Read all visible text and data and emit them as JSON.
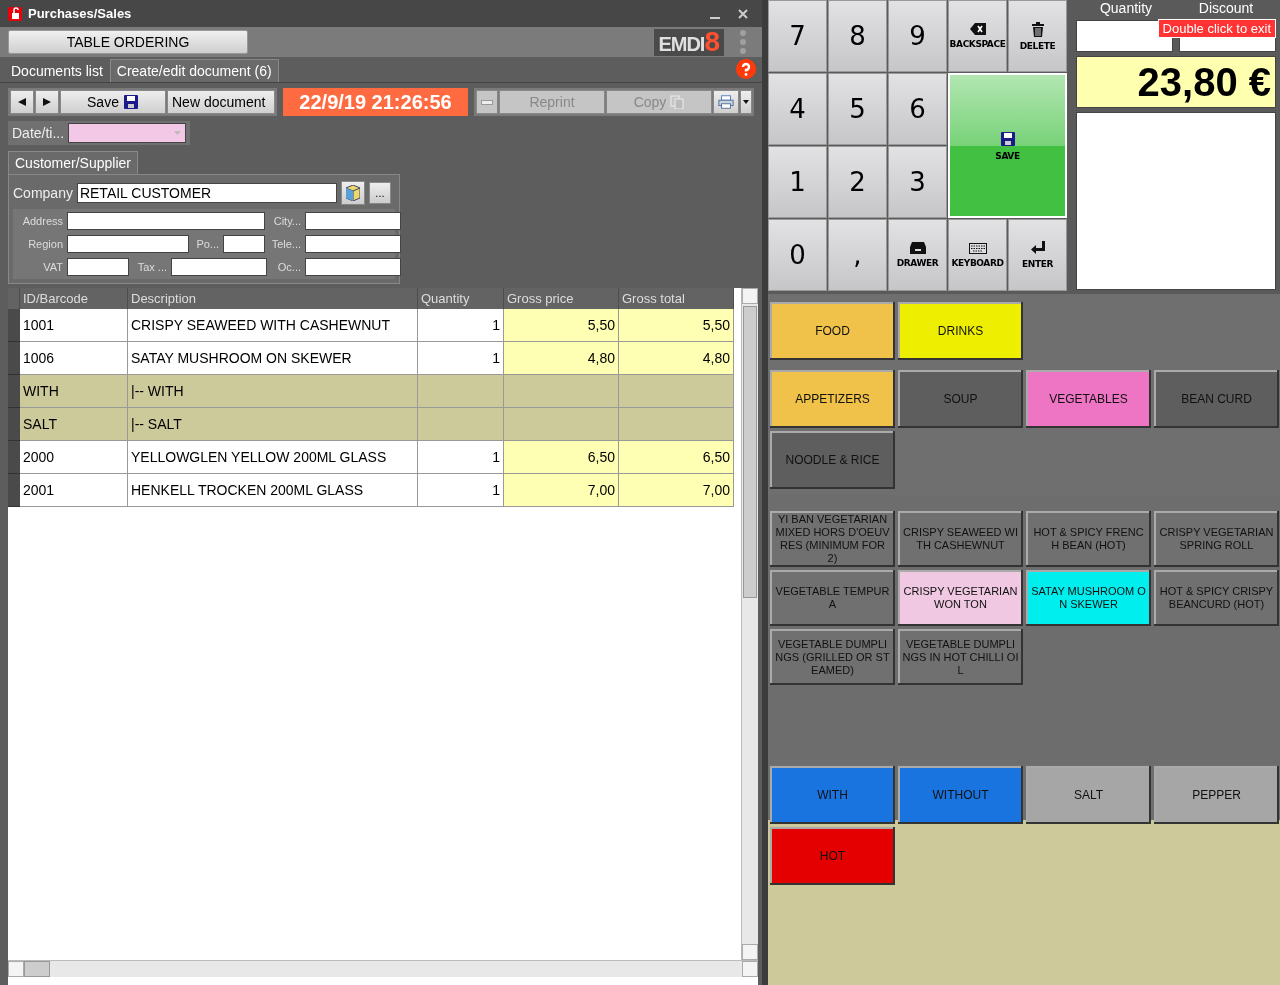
{
  "window": {
    "title": "Purchases/Sales"
  },
  "toolbar": {
    "table_button": "TABLE ORDERING",
    "logo": {
      "letters": "EMDI",
      "digit": "8"
    }
  },
  "tabs": [
    {
      "label": "Documents list",
      "selected": false
    },
    {
      "label": "Create/edit document (6)",
      "selected": true
    }
  ],
  "actions": {
    "save": "Save",
    "new_document": "New document",
    "datetime": "22/9/19 21:26:56",
    "reprint": "Reprint",
    "copy": "Copy"
  },
  "date_field": {
    "label": "Date/ti..."
  },
  "customer": {
    "tab": "Customer/Supplier",
    "company_label": "Company",
    "company": "RETAIL CUSTOMER",
    "more": "...",
    "fields": [
      {
        "label": "Address"
      },
      {
        "label": "City..."
      },
      {
        "label": "Region"
      },
      {
        "label": "Po..."
      },
      {
        "label": "Tele..."
      },
      {
        "label": "VAT"
      },
      {
        "label": "Tax ..."
      },
      {
        "label": "Oc..."
      }
    ]
  },
  "table": {
    "columns": [
      "ID/Barcode",
      "Description",
      "Quantity",
      "Gross price",
      "Gross total"
    ],
    "rows": [
      {
        "kind": "item",
        "id": "1001",
        "description": "CRISPY SEAWEED WITH CASHEWNUT",
        "quantity": "1",
        "price": "5,50",
        "total": "5,50"
      },
      {
        "kind": "item",
        "id": "1006",
        "description": "SATAY MUSHROOM ON SKEWER",
        "quantity": "1",
        "price": "4,80",
        "total": "4,80"
      },
      {
        "kind": "modifier",
        "id": "WITH",
        "description": "|-- WITH"
      },
      {
        "kind": "modifier",
        "id": "SALT",
        "description": "|-- SALT"
      },
      {
        "kind": "item",
        "id": "2000",
        "description": "YELLOWGLEN YELLOW 200ML GLASS",
        "quantity": "1",
        "price": "6,50",
        "total": "6,50"
      },
      {
        "kind": "item",
        "id": "2001",
        "description": "HENKELL TROCKEN  200ML GLASS",
        "quantity": "1",
        "price": "7,00",
        "total": "7,00"
      }
    ]
  },
  "keypad": [
    {
      "kind": "digit",
      "label": "7"
    },
    {
      "kind": "digit",
      "label": "8"
    },
    {
      "kind": "digit",
      "label": "9"
    },
    {
      "kind": "backspace",
      "label": "BACKSPACE"
    },
    {
      "kind": "delete",
      "label": "DELETE"
    },
    {
      "kind": "digit",
      "label": "4"
    },
    {
      "kind": "digit",
      "label": "5"
    },
    {
      "kind": "digit",
      "label": "6"
    },
    {
      "kind": "save",
      "label": "SAVE"
    },
    {
      "kind": "digit",
      "label": "1"
    },
    {
      "kind": "digit",
      "label": "2"
    },
    {
      "kind": "digit",
      "label": "3"
    },
    {
      "kind": "digit",
      "label": "0"
    },
    {
      "kind": "digit",
      "label": ","
    },
    {
      "kind": "drawer",
      "label": "DRAWER"
    },
    {
      "kind": "keyboard",
      "label": "KEYBOARD"
    },
    {
      "kind": "enter",
      "label": "ENTER"
    }
  ],
  "display": {
    "quantity_label": "Quantity",
    "discount_label": "Discount",
    "tooltip": "Double click to exit",
    "total": "23,80 €"
  },
  "groups": [
    {
      "label": "FOOD",
      "color": "#f0c24a"
    },
    {
      "label": "DRINKS",
      "color": "#eeee00"
    }
  ],
  "categories": [
    {
      "label": "APPETIZERS",
      "color": "#f0c24a"
    },
    {
      "label": "SOUP",
      "color": "#5e5e5e"
    },
    {
      "label": "VEGETABLES",
      "color": "#ee74c4"
    },
    {
      "label": "BEAN CURD",
      "color": "#5e5e5e"
    },
    {
      "label": "NOODLE & RICE",
      "color": "#5e5e5e"
    }
  ],
  "products": [
    {
      "label": "YI BAN VEGETARIAN MIXED HORS D'OEUVRES (MINIMUM FOR 2)",
      "color": "#707070"
    },
    {
      "label": "CRISPY SEAWEED WITH CASHEWNUT",
      "color": "#707070"
    },
    {
      "label": "HOT & SPICY FRENCH BEAN (HOT)",
      "color": "#707070"
    },
    {
      "label": "CRISPY VEGETARIAN SPRING ROLL",
      "color": "#707070"
    },
    {
      "label": "VEGETABLE TEMPURA",
      "color": "#707070"
    },
    {
      "label": "CRISPY VEGETARIAN WON TON",
      "color": "#f0c8e2"
    },
    {
      "label": "SATAY MUSHROOM ON SKEWER",
      "color": "#00eeee"
    },
    {
      "label": "HOT & SPICY CRISPY BEANCURD (HOT)",
      "color": "#707070"
    },
    {
      "label": "VEGETABLE DUMPLINGS (GRILLED OR STEAMED)",
      "color": "#707070"
    },
    {
      "label": "VEGETABLE DUMPLINGS IN HOT CHILLI OIL",
      "color": "#707070"
    }
  ],
  "modifiers": [
    {
      "label": "WITH",
      "color": "#1a74e0"
    },
    {
      "label": "WITHOUT",
      "color": "#1a74e0"
    },
    {
      "label": "SALT",
      "color": "#a6a6a6"
    },
    {
      "label": "PEPPER",
      "color": "#a6a6a6"
    },
    {
      "label": "HOT",
      "color": "#e40000"
    }
  ]
}
